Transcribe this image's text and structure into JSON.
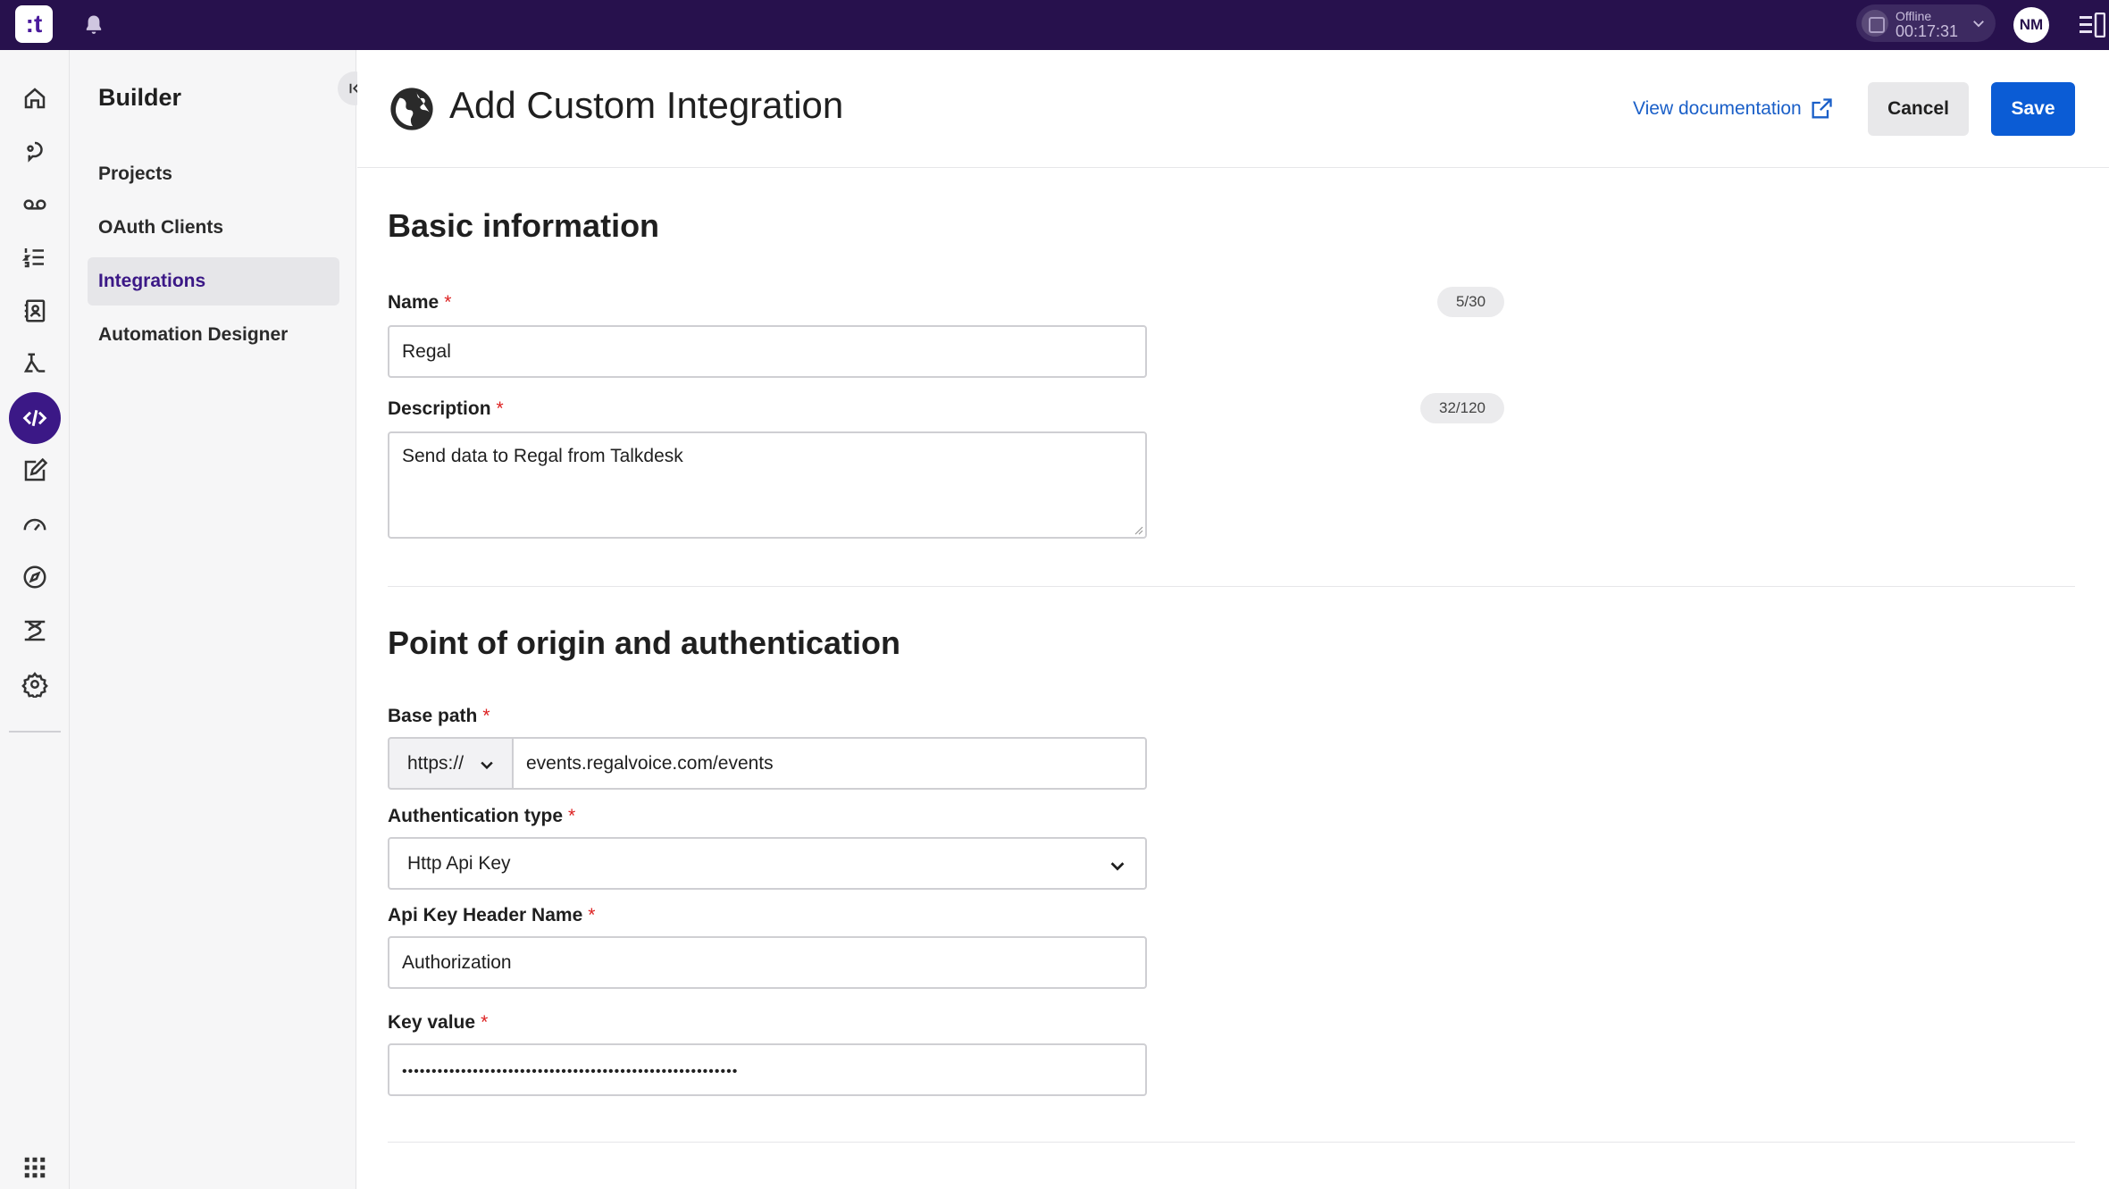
{
  "topbar": {
    "logo_text": ":t",
    "status_label": "Offline",
    "status_time": "00:17:31",
    "avatar_initials": "NM"
  },
  "sidebar": {
    "title": "Builder",
    "items": [
      {
        "label": "Projects"
      },
      {
        "label": "OAuth Clients"
      },
      {
        "label": "Integrations"
      },
      {
        "label": "Automation Designer"
      }
    ]
  },
  "header": {
    "title": "Add Custom Integration",
    "doc_link": "View documentation",
    "cancel_label": "Cancel",
    "save_label": "Save"
  },
  "basic": {
    "title": "Basic information",
    "name_label": "Name",
    "name_counter": "5/30",
    "name_value": "Regal",
    "desc_label": "Description",
    "desc_counter": "32/120",
    "desc_value": "Send data to Regal from Talkdesk"
  },
  "auth": {
    "title": "Point of origin and authentication",
    "base_path_label": "Base path",
    "scheme": "https://",
    "base_path_value": "events.regalvoice.com/events",
    "auth_type_label": "Authentication type",
    "auth_type_value": "Http Api Key",
    "header_name_label": "Api Key Header Name",
    "header_name_value": "Authorization",
    "key_value_label": "Key value",
    "key_value": "•••••••••••••••••••••••••••••••••••••••••••••••••••••••••"
  },
  "required_mark": "*",
  "colors": {
    "topbar": "#27114d",
    "accent": "#3b1886",
    "link": "#1a5fc8",
    "primary": "#0b5cd5",
    "required": "#dd2222"
  }
}
